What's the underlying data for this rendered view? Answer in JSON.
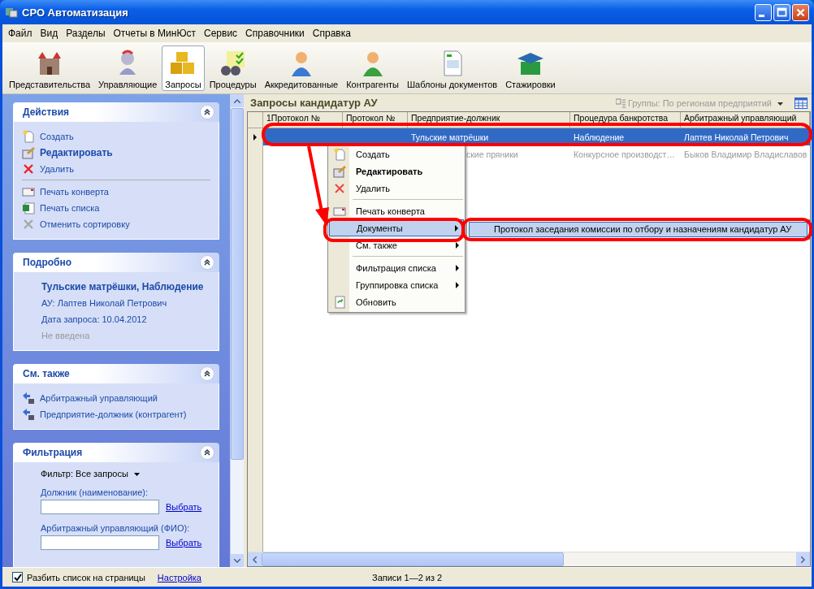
{
  "window": {
    "title": "СРО Автоматизация"
  },
  "menu": [
    "Файл",
    "Вид",
    "Разделы",
    "Отчеты в МинЮст",
    "Сервис",
    "Справочники",
    "Справка"
  ],
  "toolbar": [
    {
      "label": "Представительства",
      "selected": false
    },
    {
      "label": "Управляющие",
      "selected": false
    },
    {
      "label": "Запросы",
      "selected": true
    },
    {
      "label": "Процедуры",
      "selected": false
    },
    {
      "label": "Аккредитованные",
      "selected": false
    },
    {
      "label": "Контрагенты",
      "selected": false
    },
    {
      "label": "Шаблоны документов",
      "selected": false
    },
    {
      "label": "Стажировки",
      "selected": false
    }
  ],
  "task_pane": {
    "actions": {
      "title": "Действия",
      "items": [
        {
          "kind": "link",
          "label": "Создать",
          "bold": false,
          "disabled": false
        },
        {
          "kind": "link",
          "label": "Редактировать",
          "bold": true,
          "disabled": false
        },
        {
          "kind": "link",
          "label": "Удалить",
          "bold": false,
          "disabled": false
        },
        {
          "kind": "separator"
        },
        {
          "kind": "link",
          "label": "Печать конверта",
          "bold": false,
          "disabled": false
        },
        {
          "kind": "link",
          "label": "Печать списка",
          "bold": false,
          "disabled": false
        },
        {
          "kind": "link",
          "label": "Отменить сортировку",
          "bold": false,
          "disabled": true
        }
      ]
    },
    "details": {
      "title": "Подробно",
      "heading": "Тульские матрёшки, Наблюдение",
      "lines": [
        "АУ: Лаптев Николай Петрович",
        "Дата запроса: 10.04.2012"
      ],
      "note": "Не введена"
    },
    "see_also": {
      "title": "См. также",
      "links": [
        "Арбитражный управляющий",
        "Предприятие-должник (контрагент)"
      ]
    },
    "filter": {
      "title": "Фильтрация",
      "filter": "Фильтр: Все запросы",
      "fields": [
        {
          "label": "Должник (наименование):",
          "button": "Выбрать"
        },
        {
          "label": "Арбитражный управляющий (ФИО):",
          "button": "Выбрать"
        }
      ]
    }
  },
  "grid": {
    "title": "Запросы кандидатур АУ",
    "grouping": "Группы: По регионам предприятий",
    "columns": [
      "1Протокол №",
      "Протокол №",
      "Предприятие-должник",
      "Процедура банкротства",
      "Арбитражный управляющий"
    ],
    "rows": [
      {
        "selected": true,
        "debtor": "Тульские матрёшки",
        "procedure": "Наблюдение",
        "manager": "Лаптев Николай Петрович"
      },
      {
        "selected": false,
        "debtor": "ские пряники",
        "procedure": "Конкурсное производст…",
        "manager": "Быков Владимир Владиславов"
      }
    ]
  },
  "context_menu": {
    "items": [
      {
        "kind": "item",
        "label": "Создать",
        "bold": false,
        "submenu": false,
        "selected": false
      },
      {
        "kind": "item",
        "label": "Редактировать",
        "bold": true,
        "submenu": false,
        "selected": false
      },
      {
        "kind": "item",
        "label": "Удалить",
        "bold": false,
        "submenu": false,
        "selected": false
      },
      {
        "kind": "separator"
      },
      {
        "kind": "item",
        "label": "Печать конверта",
        "bold": false,
        "submenu": false,
        "selected": false
      },
      {
        "kind": "item",
        "label": "Документы",
        "bold": false,
        "submenu": true,
        "selected": true
      },
      {
        "kind": "item",
        "label": "См. также",
        "bold": false,
        "submenu": true,
        "selected": false
      },
      {
        "kind": "separator"
      },
      {
        "kind": "item",
        "label": "Фильтрация списка",
        "bold": false,
        "submenu": true,
        "selected": false
      },
      {
        "kind": "item",
        "label": "Группировка списка",
        "bold": false,
        "submenu": true,
        "selected": false
      },
      {
        "kind": "item",
        "label": "Обновить",
        "bold": false,
        "submenu": false,
        "selected": false
      }
    ]
  },
  "submenu": {
    "items": [
      {
        "label": "Протокол заседания комиссии по отбору и назначениям кандидатур АУ",
        "selected": true
      }
    ]
  },
  "status_bar": {
    "paginate": {
      "label": "Разбить список на страницы",
      "checked": true
    },
    "settings_link": "Настройка",
    "records": "Записи 1—2 из 2"
  }
}
